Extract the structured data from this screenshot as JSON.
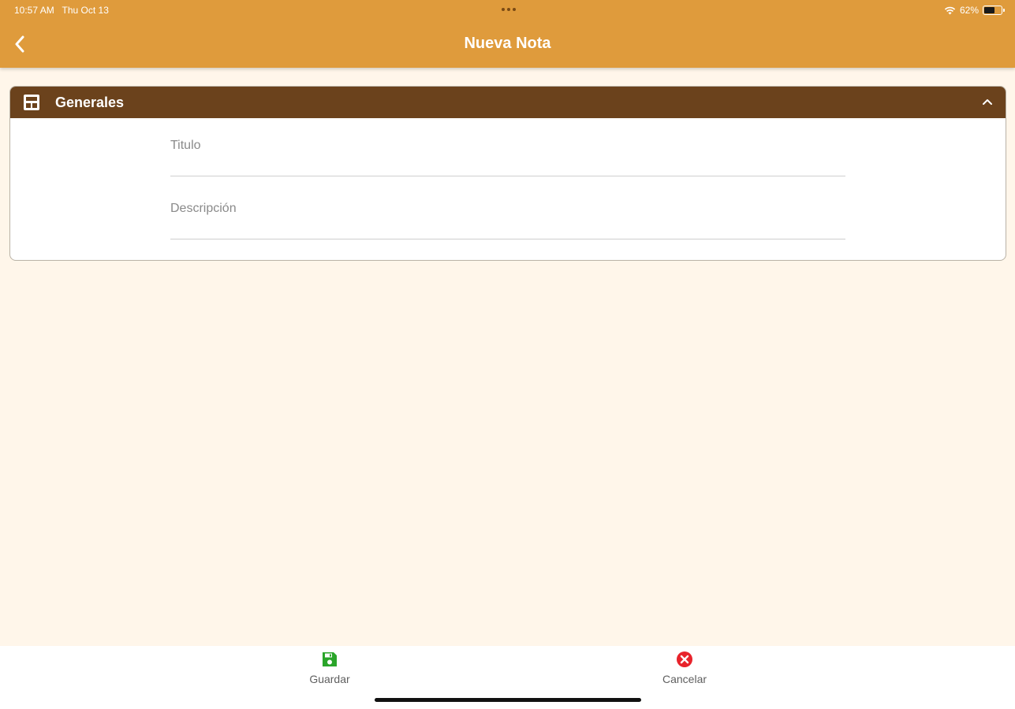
{
  "status_bar": {
    "time": "10:57 AM",
    "date": "Thu Oct 13",
    "battery": "62%",
    "battery_level": 0.62,
    "icons": [
      "wifi-icon",
      "battery-icon",
      "multitasking-dots-icon"
    ]
  },
  "nav": {
    "title": "Nueva Nota",
    "back_icon": "chevron-left-icon"
  },
  "section": {
    "title": "Generales",
    "icon": "form-layout-icon",
    "collapse_icon": "chevron-up-icon",
    "fields": [
      {
        "placeholder": "Titulo",
        "value": ""
      },
      {
        "placeholder": "Descripción",
        "value": ""
      }
    ]
  },
  "toolbar": {
    "save_label": "Guardar",
    "save_icon": "floppy-disk-icon",
    "cancel_label": "Cancelar",
    "cancel_icon": "close-circle-icon"
  },
  "colors": {
    "header": "#df9b3c",
    "section_header": "#6b421c",
    "background": "#fff6ea",
    "save": "#2aa52a",
    "cancel": "#e8232b"
  }
}
